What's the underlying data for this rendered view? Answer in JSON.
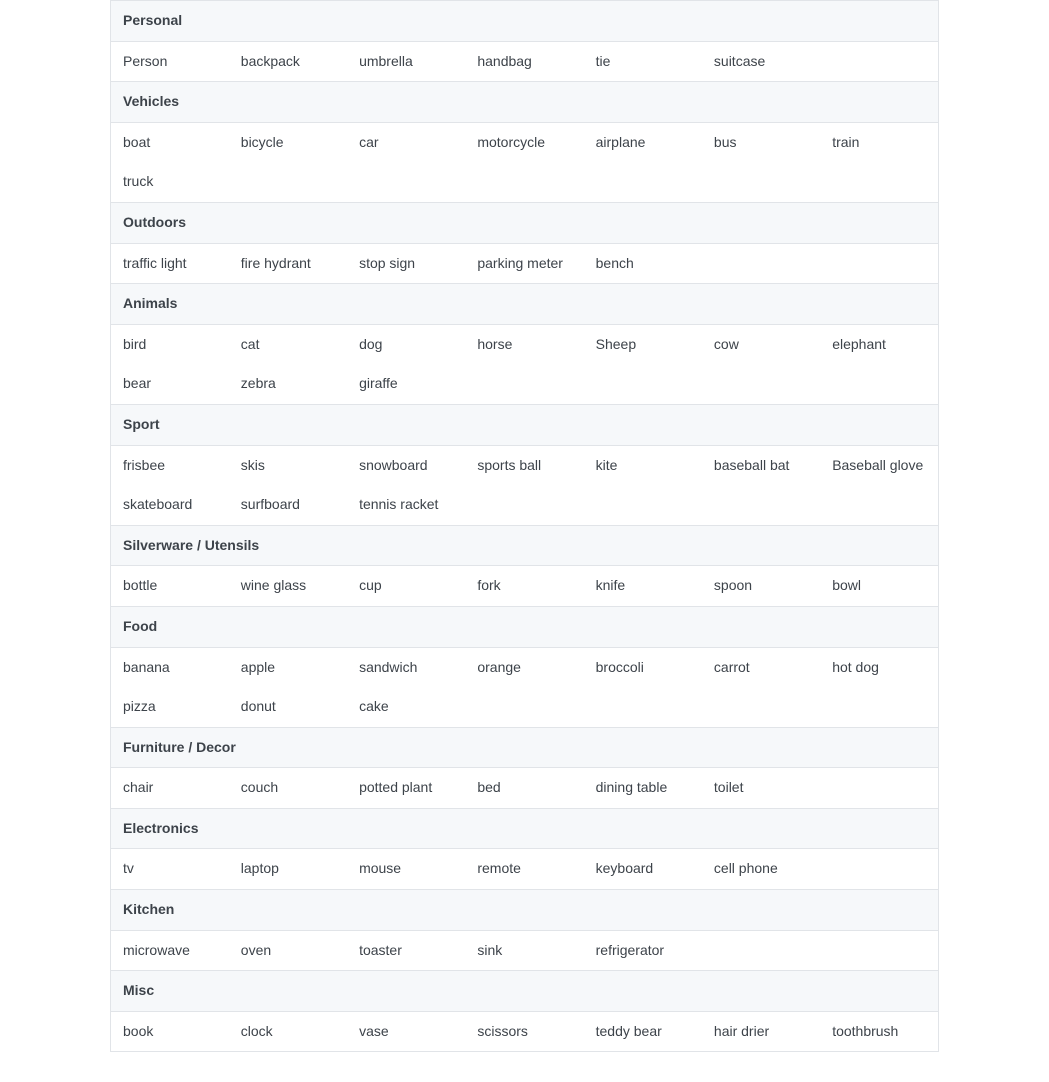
{
  "columns": 7,
  "sections": [
    {
      "title": "Personal",
      "items": [
        "Person",
        "backpack",
        "umbrella",
        "handbag",
        "tie",
        "suitcase"
      ]
    },
    {
      "title": "Vehicles",
      "items": [
        "boat",
        "bicycle",
        "car",
        "motorcycle",
        "airplane",
        "bus",
        "train",
        "truck"
      ]
    },
    {
      "title": "Outdoors",
      "items": [
        "traffic light",
        "fire hydrant",
        "stop sign",
        "parking meter",
        "bench"
      ]
    },
    {
      "title": "Animals",
      "items": [
        "bird",
        "cat",
        "dog",
        "horse",
        "Sheep",
        "cow",
        "elephant",
        "bear",
        "zebra",
        "giraffe"
      ]
    },
    {
      "title": "Sport",
      "items": [
        "frisbee",
        "skis",
        "snowboard",
        "sports ball",
        "kite",
        "baseball bat",
        "Baseball glove",
        "skateboard",
        "surfboard",
        "tennis racket"
      ]
    },
    {
      "title": "Silverware / Utensils",
      "items": [
        "bottle",
        "wine glass",
        "cup",
        "fork",
        "knife",
        "spoon",
        "bowl"
      ]
    },
    {
      "title": "Food",
      "items": [
        "banana",
        "apple",
        "sandwich",
        "orange",
        "broccoli",
        "carrot",
        "hot dog",
        "pizza",
        "donut",
        "cake"
      ]
    },
    {
      "title": "Furniture / Decor",
      "items": [
        "chair",
        "couch",
        "potted plant",
        "bed",
        "dining table",
        "toilet"
      ]
    },
    {
      "title": "Electronics",
      "items": [
        "tv",
        "laptop",
        "mouse",
        "remote",
        "keyboard",
        "cell phone"
      ]
    },
    {
      "title": "Kitchen",
      "items": [
        "microwave",
        "oven",
        "toaster",
        "sink",
        "refrigerator"
      ]
    },
    {
      "title": "Misc",
      "items": [
        "book",
        "clock",
        "vase",
        "scissors",
        "teddy bear",
        "hair drier",
        "toothbrush"
      ]
    }
  ]
}
